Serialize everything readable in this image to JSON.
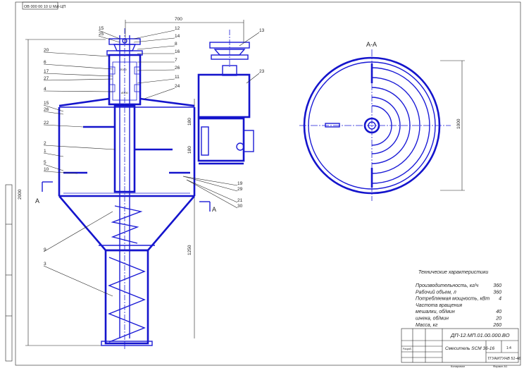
{
  "stamp_code": "ОВ 000 00 10 U Mzl-ЦП",
  "dims": {
    "width_top": "700",
    "height_total": "2000",
    "h_upper": "180",
    "h_mid": "180",
    "h_lower": "1250",
    "diameter": "1000"
  },
  "section": {
    "cut_letter": "А",
    "view_title": "А-А"
  },
  "callouts_left": [
    "20",
    "6",
    "17",
    "27",
    "4",
    "15",
    "26",
    "22",
    "2",
    "1",
    "5",
    "10",
    "9",
    "3"
  ],
  "callouts_top": [
    "15",
    "25",
    "12",
    "14",
    "8",
    "16",
    "7",
    "26",
    "11",
    "24"
  ],
  "callouts_right": [
    "13",
    "23",
    "19",
    "29",
    "21",
    "30"
  ],
  "tech": {
    "title": "Технические характеристики",
    "rows": [
      {
        "label": "Производительность, кг/ч",
        "value": "360"
      },
      {
        "label": "Рабочий объем, л",
        "value": "360"
      },
      {
        "label": "Потребляемая мощность, кВт",
        "value": "4"
      },
      {
        "label": "Частота вращения",
        "value": ""
      },
      {
        "label": "мешалки, об/мин",
        "value": "40"
      },
      {
        "label": "шнека, об/мин",
        "value": "20"
      },
      {
        "label": "Масса, кг",
        "value": "260"
      }
    ]
  },
  "title_block": {
    "doc_code": "ДП-12.МП.01.00.000.ВО",
    "name": "Смеситель SCM 36-16",
    "scale": "1:4",
    "org": "ТГУАИТУНВ 51-46",
    "left_label": "Разраб.",
    "bottom_left": "Копировал",
    "bottom_right": "Формат А1"
  }
}
